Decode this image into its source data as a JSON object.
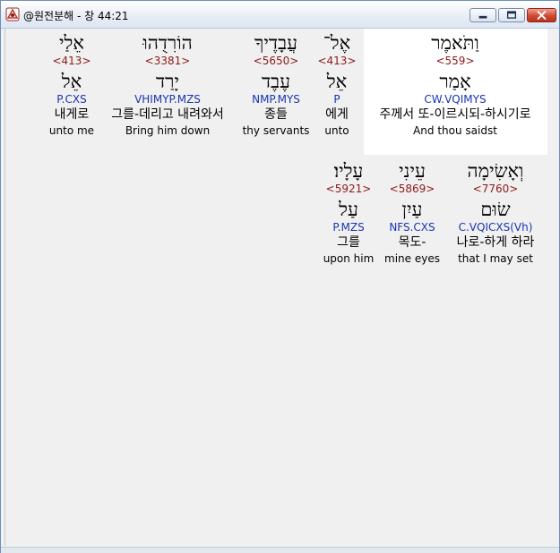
{
  "window": {
    "title": "@원전분해 - 창 44:21"
  },
  "lines": [
    {
      "words": [
        {
          "hebrew": "אֵלַי",
          "strong": "<413>",
          "lemma": "אֵל",
          "morph": "P.CXS",
          "korean": "내게로",
          "english": "unto me"
        },
        {
          "hebrew": "הוֹרִדֻהוּ",
          "strong": "<3381>",
          "lemma": "יָרַד",
          "morph": "VHIMYP.MZS",
          "korean": "그를-데리고 내려와서",
          "english": "Bring him down"
        },
        {
          "hebrew": "עֲבָדֶיךָ",
          "strong": "<5650>",
          "lemma": "עֶבֶד",
          "morph": "NMP.MYS",
          "korean": "종들",
          "english": "thy servants"
        },
        {
          "hebrew": "אֶל־",
          "strong": "<413>",
          "lemma": "אֵל",
          "morph": "P",
          "korean": "에게",
          "english": "unto"
        },
        {
          "hebrew": "וַתֹּאמֶר",
          "strong": "<559>",
          "lemma": "אָמַר",
          "morph": "CW.VQIMYS",
          "korean": "주께서 또-이르시되-하시기로",
          "english": "And thou saidst",
          "selected": true
        }
      ]
    },
    {
      "words": [
        {
          "hebrew": "עָלָיו׃",
          "strong": "<5921>",
          "lemma": "עַל",
          "morph": "P.MZS",
          "korean": "그를",
          "english": "upon him"
        },
        {
          "hebrew": "עֵינִי",
          "strong": "<5869>",
          "lemma": "עַיִן",
          "morph": "NFS.CXS",
          "korean": "목도-",
          "english": "mine eyes"
        },
        {
          "hebrew": "וְאָשִׂימָה",
          "strong": "<7760>",
          "lemma": "שׂוּם",
          "morph": "C.VQICXS(Vh)",
          "korean": "나로-하게 하라",
          "english": "that I may set"
        }
      ]
    }
  ]
}
